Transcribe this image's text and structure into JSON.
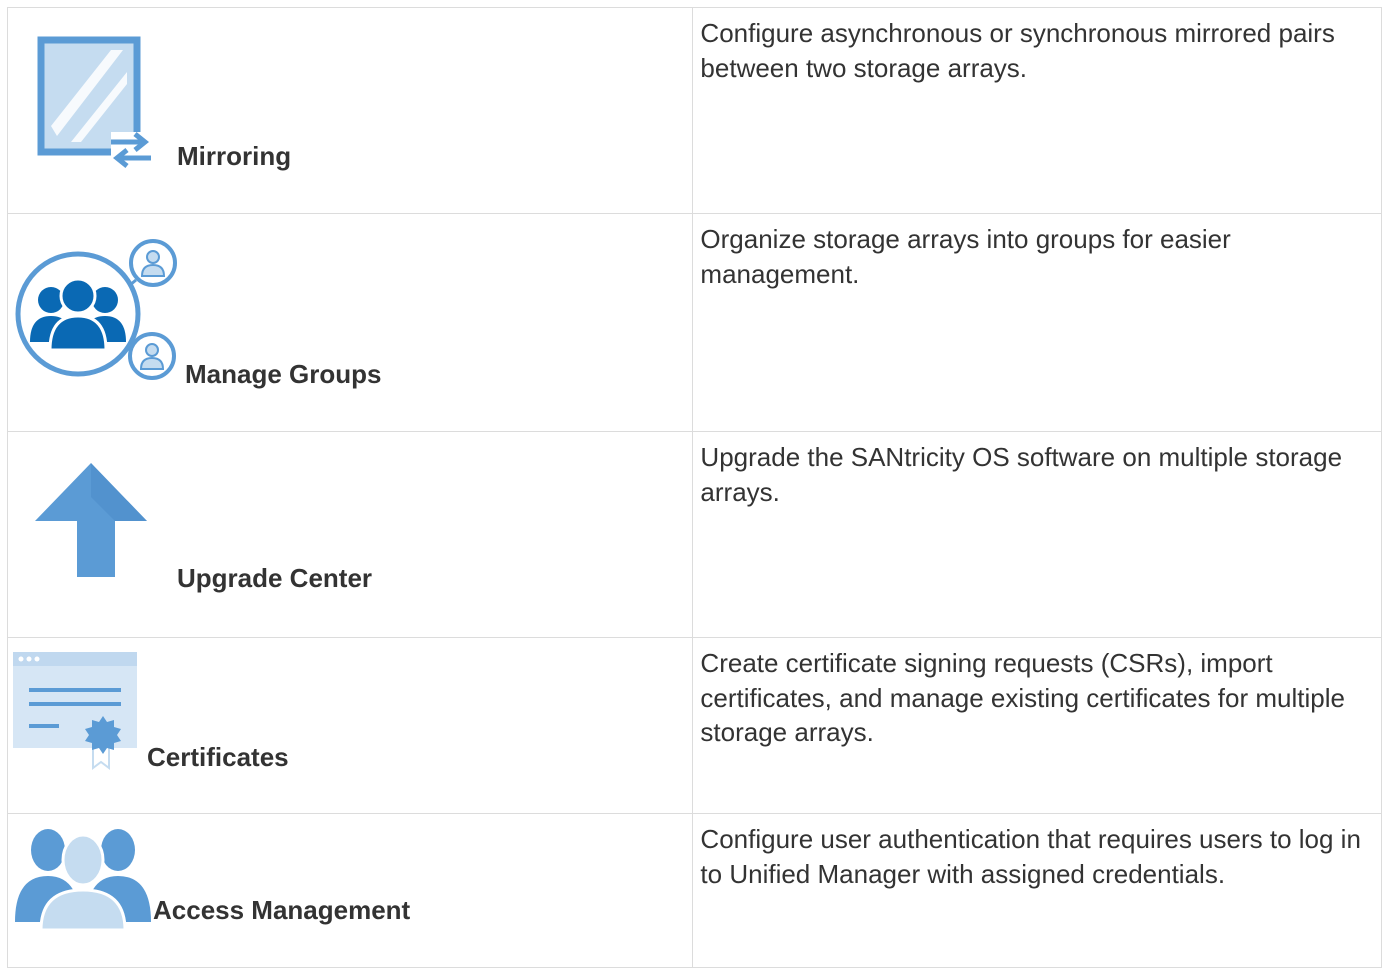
{
  "colors": {
    "icon_blue": "#5b9bd5",
    "icon_light": "#c5dcf0",
    "group_dark": "#0a69b4",
    "border": "#dcdcdc",
    "text": "#333333"
  },
  "features": [
    {
      "icon": "mirror-icon",
      "name": "Mirroring",
      "description": "Configure asynchronous or synchronous mirrored pairs between two storage arrays."
    },
    {
      "icon": "groups-icon",
      "name": "Manage Groups",
      "description": "Organize storage arrays into groups for easier management."
    },
    {
      "icon": "upgrade-arrow-icon",
      "name": "Upgrade Center",
      "description": "Upgrade the SANtricity OS software on multiple storage arrays."
    },
    {
      "icon": "certificate-icon",
      "name": "Certificates",
      "description": "Create certificate signing requests (CSRs), import certificates, and manage existing certificates for multiple storage arrays."
    },
    {
      "icon": "users-icon",
      "name": "Access Management",
      "description": "Configure user authentication that requires users to log in to Unified Manager with assigned credentials."
    }
  ]
}
